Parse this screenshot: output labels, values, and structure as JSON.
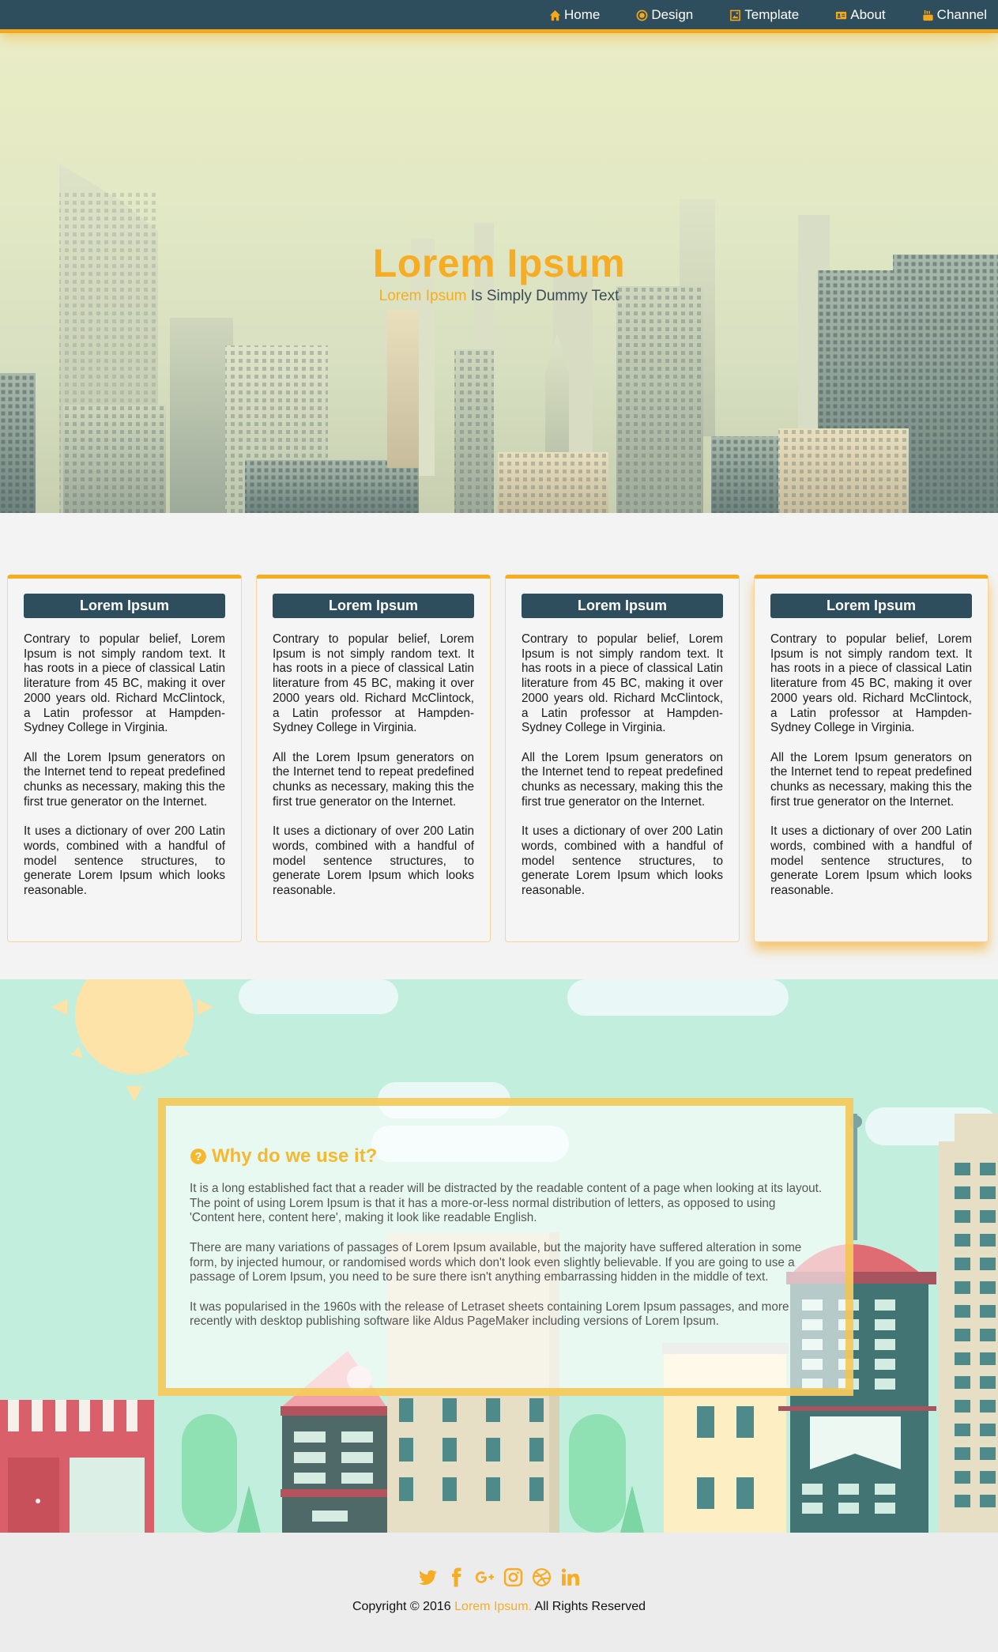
{
  "nav": {
    "items": [
      {
        "label": "Home",
        "icon": "home-icon"
      },
      {
        "label": "Design",
        "icon": "record-icon"
      },
      {
        "label": "Template",
        "icon": "picture-icon"
      },
      {
        "label": "About",
        "icon": "id-card-icon"
      },
      {
        "label": "Channel",
        "icon": "youtube-icon"
      }
    ]
  },
  "hero": {
    "title": "Lorem Ipsum",
    "subtitle_accent": "Lorem Ipsum",
    "subtitle_rest": " Is Simply Dummy Text"
  },
  "cards": [
    {
      "title": "Lorem Ipsum",
      "p1": "Contrary to popular belief, Lorem Ipsum is not simply random text. It has roots in a piece of classical Latin literature from 45 BC, making it over 2000 years old. Richard McClintock, a Latin professor at Hampden-Sydney College in Virginia.",
      "p2": "All the Lorem Ipsum generators on the Internet tend to repeat predefined chunks as necessary, making this the first true generator on the Internet.",
      "p3": "It uses a dictionary of over 200 Latin words, combined with a handful of model sentence structures, to generate Lorem Ipsum which looks reasonable."
    },
    {
      "title": "Lorem Ipsum",
      "p1": "Contrary to popular belief, Lorem Ipsum is not simply random text. It has roots in a piece of classical Latin literature from 45 BC, making it over 2000 years old. Richard McClintock, a Latin professor at Hampden-Sydney College in Virginia.",
      "p2": "All the Lorem Ipsum generators on the Internet tend to repeat predefined chunks as necessary, making this the first true generator on the Internet.",
      "p3": "It uses a dictionary of over 200 Latin words, combined with a handful of model sentence structures, to generate Lorem Ipsum which looks reasonable."
    },
    {
      "title": "Lorem Ipsum",
      "p1": "Contrary to popular belief, Lorem Ipsum is not simply random text. It has roots in a piece of classical Latin literature from 45 BC, making it over 2000 years old. Richard McClintock, a Latin professor at Hampden-Sydney College in Virginia.",
      "p2": "All the Lorem Ipsum generators on the Internet tend to repeat predefined chunks as necessary, making this the first true generator on the Internet.",
      "p3": "It uses a dictionary of over 200 Latin words, combined with a handful of model sentence structures, to generate Lorem Ipsum which looks reasonable."
    },
    {
      "title": "Lorem Ipsum",
      "p1": "Contrary to popular belief, Lorem Ipsum is not simply random text. It has roots in a piece of classical Latin literature from 45 BC, making it over 2000 years old. Richard McClintock, a Latin professor at Hampden-Sydney College in Virginia.",
      "p2": "All the Lorem Ipsum generators on the Internet tend to repeat predefined chunks as necessary, making this the first true generator on the Internet.",
      "p3": "It uses a dictionary of over 200 Latin words, combined with a handful of model sentence structures, to generate Lorem Ipsum which looks reasonable."
    }
  ],
  "why": {
    "title": "Why do we use it?",
    "icon": "question-circle-icon",
    "p1": "It is a long established fact that a reader will be distracted by the readable content of a page when looking at its layout. The point of using Lorem Ipsum is that it has a more-or-less normal distribution of letters, as opposed to using 'Content here, content here', making it look like readable English.",
    "p2": "There are many variations of passages of Lorem Ipsum available, but the majority have suffered alteration in some form, by injected humour, or randomised words which don't look even slightly believable. If you are going to use a passage of Lorem Ipsum, you need to be sure there isn't anything embarrassing hidden in the middle of text.",
    "p3": "It was popularised in the 1960s with the release of Letraset sheets containing Lorem Ipsum passages, and more recently with desktop publishing software like Aldus PageMaker including versions of Lorem Ipsum."
  },
  "footer": {
    "socials": [
      "twitter-icon",
      "facebook-icon",
      "google-plus-icon",
      "instagram-icon",
      "dribbble-icon",
      "linkedin-icon"
    ],
    "copyright_prefix": "Copyright © 2016 ",
    "copyright_brand": "Lorem Ipsum.",
    "copyright_suffix": " All Rights Reserved"
  },
  "colors": {
    "accent": "#f6ad24",
    "nav_bg": "#2e4e5d",
    "card_title_bg": "#2e4e5d",
    "city_bg": "#c2eedd",
    "footer_bg": "#ececec"
  }
}
